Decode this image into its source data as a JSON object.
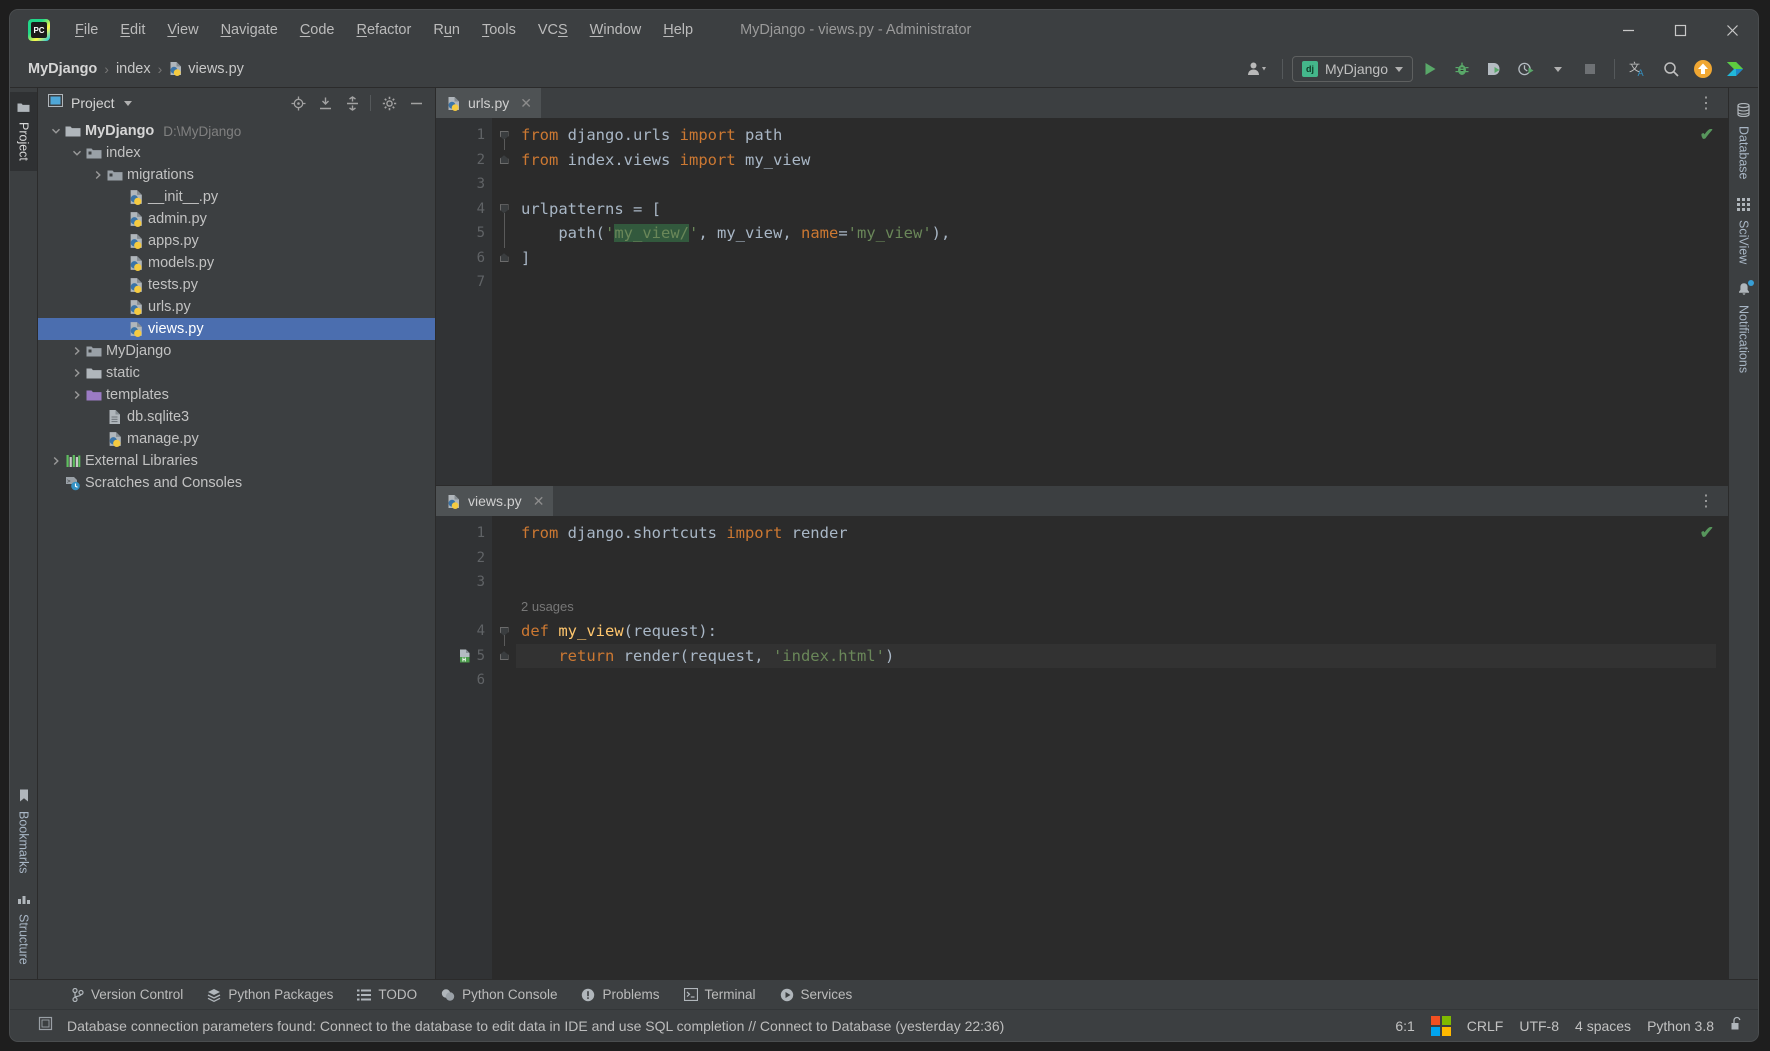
{
  "window": {
    "title": "MyDjango - views.py - Administrator",
    "app_icon": "pycharm-logo-icon",
    "minimize": "minimize-icon",
    "maximize": "maximize-icon",
    "close": "close-icon"
  },
  "menubar": [
    {
      "label": "File",
      "mnemonic": "F"
    },
    {
      "label": "Edit",
      "mnemonic": "E"
    },
    {
      "label": "View",
      "mnemonic": "V"
    },
    {
      "label": "Navigate",
      "mnemonic": "N"
    },
    {
      "label": "Code",
      "mnemonic": "C"
    },
    {
      "label": "Refactor",
      "mnemonic": "R"
    },
    {
      "label": "Run",
      "mnemonic": "u"
    },
    {
      "label": "Tools",
      "mnemonic": "T"
    },
    {
      "label": "VCS",
      "mnemonic": "S"
    },
    {
      "label": "Window",
      "mnemonic": "W"
    },
    {
      "label": "Help",
      "mnemonic": "H"
    }
  ],
  "toolbar": {
    "breadcrumb": [
      "MyDjango",
      "index",
      "views.py"
    ],
    "breadcrumb_file_icon": "python-file-icon",
    "account_icon": "user-account-icon",
    "run_config": {
      "badge": "dj",
      "name": "MyDjango"
    },
    "run_label": "run-button",
    "debug_label": "debug-button",
    "coverage_label": "run-with-coverage-button",
    "profile_label": "profile-button",
    "stop_label": "stop-button",
    "translate_label": "translate-button",
    "search_label": "search-everywhere-button",
    "update_label": "update-project-button",
    "brand_label": "toolbox-button"
  },
  "left_rail": {
    "top": [
      {
        "label": "Project",
        "icon": "project-folder-icon",
        "active": true
      }
    ],
    "bottom": [
      {
        "label": "Bookmarks",
        "icon": "bookmark-icon",
        "active": false
      },
      {
        "label": "Structure",
        "icon": "structure-icon",
        "active": false
      }
    ]
  },
  "right_rail": [
    {
      "label": "Database",
      "icon": "database-icon",
      "badge": false
    },
    {
      "label": "SciView",
      "icon": "grid-icon",
      "badge": false
    },
    {
      "label": "Notifications",
      "icon": "bell-icon",
      "badge": true
    }
  ],
  "project_panel": {
    "title": "Project",
    "view_dropdown": "project-view-dropdown",
    "icons": [
      "locate-icon",
      "expand-all-icon",
      "collapse-all-icon",
      "settings-gear-icon",
      "hide-icon"
    ],
    "tree": [
      {
        "depth": 0,
        "twisty": "down",
        "icon": "folder-icon",
        "label": "MyDjango",
        "path": "D:\\MyDjango",
        "bold": true,
        "selected": false
      },
      {
        "depth": 1,
        "twisty": "down",
        "icon": "module-folder-icon",
        "label": "index",
        "path": "",
        "bold": false,
        "selected": false
      },
      {
        "depth": 2,
        "twisty": "right",
        "icon": "module-folder-icon",
        "label": "migrations",
        "path": "",
        "bold": false,
        "selected": false
      },
      {
        "depth": 3,
        "twisty": "none",
        "icon": "python-file-icon",
        "label": "__init__.py",
        "path": "",
        "bold": false,
        "selected": false
      },
      {
        "depth": 3,
        "twisty": "none",
        "icon": "python-file-icon",
        "label": "admin.py",
        "path": "",
        "bold": false,
        "selected": false
      },
      {
        "depth": 3,
        "twisty": "none",
        "icon": "python-file-icon",
        "label": "apps.py",
        "path": "",
        "bold": false,
        "selected": false
      },
      {
        "depth": 3,
        "twisty": "none",
        "icon": "python-file-icon",
        "label": "models.py",
        "path": "",
        "bold": false,
        "selected": false
      },
      {
        "depth": 3,
        "twisty": "none",
        "icon": "python-file-icon",
        "label": "tests.py",
        "path": "",
        "bold": false,
        "selected": false
      },
      {
        "depth": 3,
        "twisty": "none",
        "icon": "python-file-icon",
        "label": "urls.py",
        "path": "",
        "bold": false,
        "selected": false
      },
      {
        "depth": 3,
        "twisty": "none",
        "icon": "python-file-icon",
        "label": "views.py",
        "path": "",
        "bold": false,
        "selected": true
      },
      {
        "depth": 1,
        "twisty": "right",
        "icon": "module-folder-icon",
        "label": "MyDjango",
        "path": "",
        "bold": false,
        "selected": false
      },
      {
        "depth": 1,
        "twisty": "right",
        "icon": "folder-icon",
        "label": "static",
        "path": "",
        "bold": false,
        "selected": false
      },
      {
        "depth": 1,
        "twisty": "right",
        "icon": "templates-folder-icon",
        "label": "templates",
        "path": "",
        "bold": false,
        "selected": false
      },
      {
        "depth": 2,
        "twisty": "none",
        "icon": "db-file-icon",
        "label": "db.sqlite3",
        "path": "",
        "bold": false,
        "selected": false
      },
      {
        "depth": 2,
        "twisty": "none",
        "icon": "python-file-icon",
        "label": "manage.py",
        "path": "",
        "bold": false,
        "selected": false
      },
      {
        "depth": 0,
        "twisty": "right",
        "icon": "libraries-icon",
        "label": "External Libraries",
        "path": "",
        "bold": false,
        "selected": false
      },
      {
        "depth": 0,
        "twisty": "none",
        "icon": "scratches-icon",
        "label": "Scratches and Consoles",
        "path": "",
        "bold": false,
        "selected": false
      }
    ]
  },
  "editor_top": {
    "tab": {
      "label": "urls.py",
      "icon": "python-file-icon",
      "close": "close-tab-icon"
    },
    "more": "editor-options-icon",
    "inspection": "✔",
    "lines": [
      {
        "num": "1",
        "fold": "top",
        "tokens": [
          {
            "t": "from ",
            "c": "k"
          },
          {
            "t": "django.urls ",
            "c": "id"
          },
          {
            "t": "import ",
            "c": "k"
          },
          {
            "t": "path",
            "c": "id"
          }
        ]
      },
      {
        "num": "2",
        "fold": "bot",
        "tokens": [
          {
            "t": "from ",
            "c": "k"
          },
          {
            "t": "index.views ",
            "c": "id"
          },
          {
            "t": "import ",
            "c": "k"
          },
          {
            "t": "my_view",
            "c": "id"
          }
        ]
      },
      {
        "num": "3",
        "fold": "none",
        "tokens": []
      },
      {
        "num": "4",
        "fold": "top",
        "tokens": [
          {
            "t": "urlpatterns ",
            "c": "id"
          },
          {
            "t": "= [",
            "c": "p"
          }
        ]
      },
      {
        "num": "5",
        "fold": "none",
        "tokens": [
          {
            "t": "    path(",
            "c": "p"
          },
          {
            "t": "'",
            "c": "s"
          },
          {
            "t": "my_view/",
            "c": "s-hl"
          },
          {
            "t": "'",
            "c": "s"
          },
          {
            "t": ", my_view, ",
            "c": "p"
          },
          {
            "t": "name",
            "c": "k"
          },
          {
            "t": "=",
            "c": "p"
          },
          {
            "t": "'my_view'",
            "c": "s"
          },
          {
            "t": "),",
            "c": "p"
          }
        ]
      },
      {
        "num": "6",
        "fold": "bot",
        "tokens": [
          {
            "t": "]",
            "c": "p"
          }
        ]
      },
      {
        "num": "7",
        "fold": "none",
        "tokens": []
      }
    ]
  },
  "editor_bottom": {
    "tab": {
      "label": "views.py",
      "icon": "python-file-icon",
      "close": "close-tab-icon"
    },
    "more": "editor-options-icon",
    "inspection": "✔",
    "usages_hint": "2 usages",
    "lines": [
      {
        "num": "1",
        "fold": "none",
        "tokens": [
          {
            "t": "from ",
            "c": "k"
          },
          {
            "t": "django.shortcuts ",
            "c": "id"
          },
          {
            "t": "import ",
            "c": "k"
          },
          {
            "t": "render",
            "c": "id"
          }
        ]
      },
      {
        "num": "2",
        "fold": "none",
        "tokens": []
      },
      {
        "num": "3",
        "fold": "none",
        "tokens": []
      },
      {
        "num": "hint",
        "fold": "none",
        "hint": "2 usages"
      },
      {
        "num": "4",
        "fold": "top",
        "tokens": [
          {
            "t": "def ",
            "c": "k"
          },
          {
            "t": "my_view",
            "c": "fn"
          },
          {
            "t": "(request):",
            "c": "p"
          }
        ]
      },
      {
        "num": "5",
        "fold": "bot",
        "gutter_icon": "html-template-icon",
        "highlight": true,
        "tokens": [
          {
            "t": "    ",
            "c": "p"
          },
          {
            "t": "return ",
            "c": "k"
          },
          {
            "t": "render(request, ",
            "c": "p"
          },
          {
            "t": "'index.html'",
            "c": "s"
          },
          {
            "t": ")",
            "c": "p"
          }
        ]
      },
      {
        "num": "6",
        "fold": "none",
        "tokens": []
      }
    ]
  },
  "tool_windows": [
    {
      "label": "Version Control",
      "icon": "branch-icon"
    },
    {
      "label": "Python Packages",
      "icon": "packages-icon"
    },
    {
      "label": "TODO",
      "icon": "list-icon"
    },
    {
      "label": "Python Console",
      "icon": "python-icon"
    },
    {
      "label": "Problems",
      "icon": "warning-icon"
    },
    {
      "label": "Terminal",
      "icon": "terminal-icon"
    },
    {
      "label": "Services",
      "icon": "services-icon"
    }
  ],
  "statusbar": {
    "icon": "notification-widget-icon",
    "message": "Database connection parameters found: Connect to the database to edit data in IDE and use SQL completion // Connect to Database (yesterday 22:36)",
    "caret_position": "6:1",
    "os_icon": "windows-logo-icon",
    "line_separator": "CRLF",
    "encoding": "UTF-8",
    "indent": "4 spaces",
    "interpreter": "Python 3.8",
    "lock_icon": "unlocked-icon"
  },
  "colors": {
    "panel": "#3c3f41",
    "editor_bg": "#2b2b2b",
    "gutter_bg": "#313335",
    "selection": "#4b6eaf",
    "keyword": "#cc7832",
    "string": "#6a8759",
    "function": "#ffc66d",
    "identifier": "#a9b7c6",
    "accent_green": "#57965c"
  }
}
